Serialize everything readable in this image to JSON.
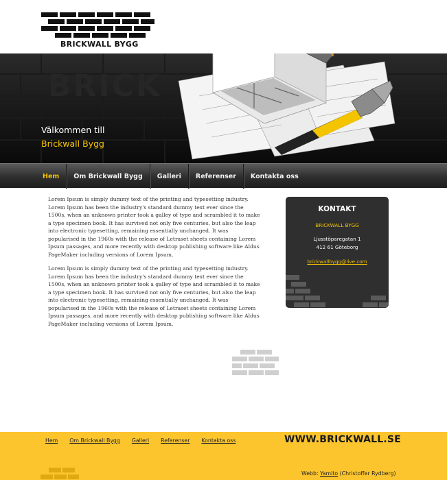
{
  "logo": {
    "text": "BRICKWALL BYGG"
  },
  "hero": {
    "welcome_line1": "Välkommen till",
    "welcome_line2": "Brickwall Bygg"
  },
  "nav": {
    "items": [
      {
        "label": "Hem",
        "active": true
      },
      {
        "label": "Om Brickwall Bygg",
        "active": false
      },
      {
        "label": "Galleri",
        "active": false
      },
      {
        "label": "Referenser",
        "active": false
      },
      {
        "label": "Kontakta oss",
        "active": false
      }
    ]
  },
  "main": {
    "paragraphs": [
      "Lorem Ipsum is simply dummy text of the printing and typesetting industry. Lorem Ipsum has been the industry's standard dummy text ever since the 1500s, when an unknown printer took a galley of type and scrambled it to make a type specimen book. It has survived not only five centuries, but also the leap into electronic typesetting, remaining essentially unchanged. It was popularised in the 1960s with the release of Letraset sheets containing Lorem Ipsum passages, and more recently with desktop publishing software like Aldus PageMaker including versions of Lorem Ipsum.",
      "Lorem Ipsum is simply dummy text of the printing and typesetting industry. Lorem Ipsum has been the industry's standard dummy text ever since the 1500s, when an unknown printer took a galley of type and scrambled it to make a type specimen book. It has survived not only five centuries, but also the leap into electronic typesetting, remaining essentially unchanged. It was popularised in the 1960s with the release of Letraset sheets containing Lorem Ipsum passages, and more recently with desktop publishing software like Aldus PageMaker including versions of Lorem Ipsum."
    ]
  },
  "contact": {
    "title": "KONTAKT",
    "company": "BRICKWALL BYGG",
    "street": "Ljusstöparegatan 1",
    "city": "412 61 Göteborg",
    "email": "brickwallbygg@live.com"
  },
  "footer": {
    "nav": [
      "Hem",
      "Om Brickwall Bygg",
      "Galleri",
      "Referenser",
      "Kontakta oss"
    ],
    "url": "WWW.BRICKWALL.SE",
    "credit_prefix": "Webb: ",
    "credit_link": "Yamito",
    "credit_suffix": " (Christoffer Rydberg)"
  },
  "colors": {
    "accent_yellow": "#f4c400",
    "footer_yellow": "#fcc52d",
    "dark": "#2f2f2f"
  },
  "icons": [
    "brick-logo-icon",
    "house-illustration",
    "hammer-icon",
    "brick-decoration-icon"
  ]
}
